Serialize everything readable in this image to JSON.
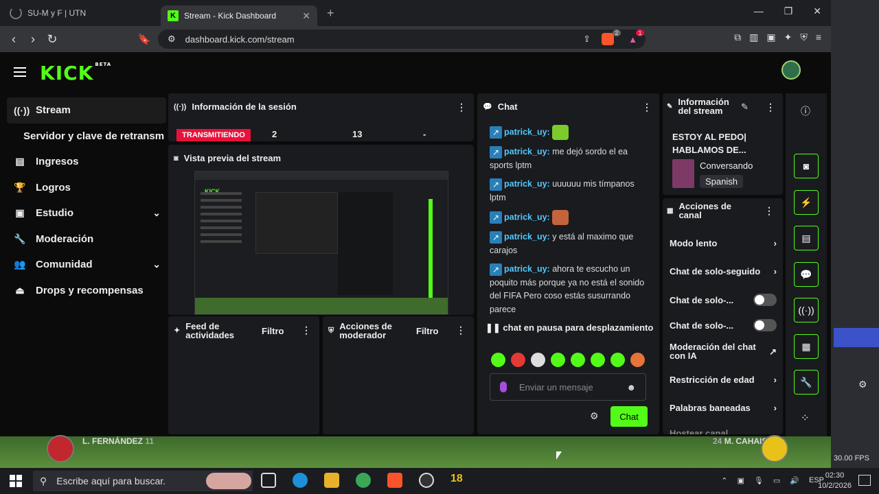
{
  "browser": {
    "tabs": [
      {
        "label": "SU-M y F | UTN"
      },
      {
        "label": "Stream - Kick Dashboard"
      }
    ],
    "url": "dashboard.kick.com/stream",
    "brave_badge": "2",
    "notif_badge": "1"
  },
  "header": {
    "logo": "KICK",
    "beta": "BETA"
  },
  "sidebar": {
    "items": [
      {
        "label": "Stream",
        "icon": "broadcast-icon"
      },
      {
        "label": "Servidor y clave de retransm",
        "icon": ""
      },
      {
        "label": "Ingresos",
        "icon": "chart-icon"
      },
      {
        "label": "Logros",
        "icon": "trophy-icon"
      },
      {
        "label": "Estudio",
        "icon": "studio-icon"
      },
      {
        "label": "Moderación",
        "icon": "wrench-icon"
      },
      {
        "label": "Comunidad",
        "icon": "people-icon"
      },
      {
        "label": "Drops y recompensas",
        "icon": "drops-icon"
      }
    ]
  },
  "session": {
    "title": "Información de la sesión",
    "status": "TRANSMITIENDO",
    "viewers": "2",
    "followers": "13",
    "duration": "-"
  },
  "preview": {
    "title": "Vista previa del stream"
  },
  "feed": {
    "title_line1": "Feed de",
    "title_line2": "actividades",
    "filter": "Filtro"
  },
  "modactions": {
    "title_line1": "Acciones de",
    "title_line2": "moderador",
    "filter": "Filtro"
  },
  "chat": {
    "title": "Chat",
    "messages": [
      {
        "user": "patrick_uy",
        "text": ""
      },
      {
        "user": "patrick_uy",
        "text": "me dejó sordo el ea sports lptm"
      },
      {
        "user": "patrick_uy",
        "text": "uuuuuu mis tímpanos lptm"
      },
      {
        "user": "patrick_uy",
        "text": ""
      },
      {
        "user": "patrick_uy",
        "text": "y está al maximo que carajos"
      },
      {
        "user": "patrick_uy",
        "text": "ahora te escucho un poquito más porque ya no está el sonido del FIFA Pero coso estás susurrando parece"
      }
    ],
    "paused": "chat en pausa para desplazamiento",
    "placeholder": "Enviar un mensaje",
    "send": "Chat"
  },
  "streaminfo": {
    "title_line1": "Información",
    "title_line2": "del stream",
    "stream_title": "ESTOY AL PEDO| HABLAMOS DE...",
    "category": "Conversando",
    "language": "Spanish"
  },
  "channelactions": {
    "title_line1": "Acciones de",
    "title_line2": "canal",
    "items": [
      {
        "label": "Modo lento"
      },
      {
        "label": "Chat de solo-seguido"
      },
      {
        "label": "Chat de solo-..."
      },
      {
        "label": "Chat de solo-..."
      },
      {
        "label": "Moderación del chat con IA"
      },
      {
        "label": "Restricción de edad"
      },
      {
        "label": "Palabras baneadas"
      },
      {
        "label": "Hostear canal"
      }
    ]
  },
  "game": {
    "left_player": "L. FERNÁNDEZ",
    "left_num": "11",
    "right_player": "M. CAHAIS",
    "right_num": "24"
  },
  "obs": {
    "fps": "30.00 FPS"
  },
  "taskbar": {
    "search": "Escribe aquí para buscar.",
    "lang": "ESP",
    "time": "02:30",
    "date": "10/2/2026",
    "app_badge": "18"
  }
}
